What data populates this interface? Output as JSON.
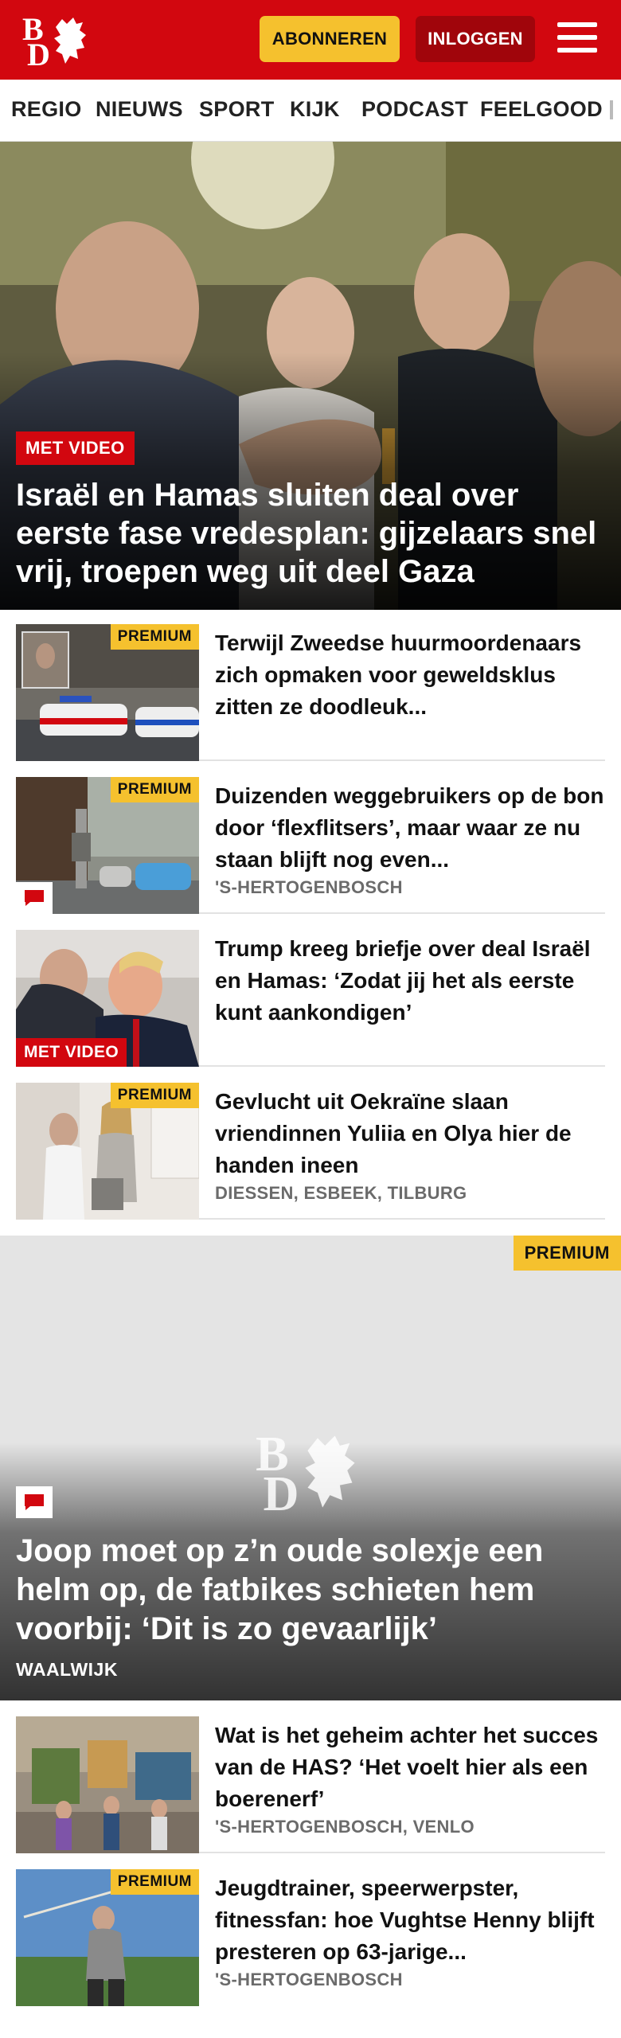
{
  "header": {
    "subscribe_label": "ABONNEREN",
    "login_label": "INLOGGEN",
    "brand_color": "#d2070f",
    "accent_color": "#f5c12e",
    "logo_letters": "BD"
  },
  "nav": {
    "items": [
      "REGIO",
      "NIEUWS",
      "SPORT",
      "KIJK",
      "PODCAST",
      "FEELGOOD"
    ]
  },
  "hero": {
    "tag": "MET VIDEO",
    "title": "Israël en Hamas sluiten deal over eerste fase vredesplan: gijzelaars snel vrij, troepen weg uit deel Gaza"
  },
  "articles": [
    {
      "title": "Terwijl Zweedse huurmoorde­naars zich opmaken voor geweldsklus zitten ze doodleuk...",
      "badge": "PREMIUM",
      "location": ""
    },
    {
      "title": "Duizenden weggebruikers op de bon door ‘flexflitsers’, maar waar ze nu staan blijft nog even...",
      "badge": "PREMIUM",
      "location": "'S-HERTOGENBOSCH"
    },
    {
      "title": "Trump kreeg briefje over deal Israël en Hamas: ‘Zodat jij het als eerste kunt aankondigen’",
      "tag": "MET VIDEO",
      "location": ""
    },
    {
      "title": "Gevlucht uit Oekraïne slaan vriendinnen Yuliia en Olya hier de handen ineen",
      "badge": "PREMIUM",
      "location": "DIESSEN, ESBEEK, TILBURG"
    }
  ],
  "feature": {
    "badge": "PREMIUM",
    "title": "Joop moet op z’n oude solexje een helm op, de fatbikes schieten hem voorbij: ‘Dit is zo gevaarlijk’",
    "location": "WAALWIJK"
  },
  "articles2": [
    {
      "title": "Wat is het geheim achter het succes van de HAS? ‘Het voelt hier als een boerenerf’",
      "location": "'S-HERTOGENBOSCH, VENLO"
    },
    {
      "title": "Jeugdtrainer, speerwerpster, fitnessfan: hoe Vughtse Henny blijft presteren op 63-jarige...",
      "badge": "PREMIUM",
      "location": "'S-HERTOGENBOSCH"
    }
  ]
}
